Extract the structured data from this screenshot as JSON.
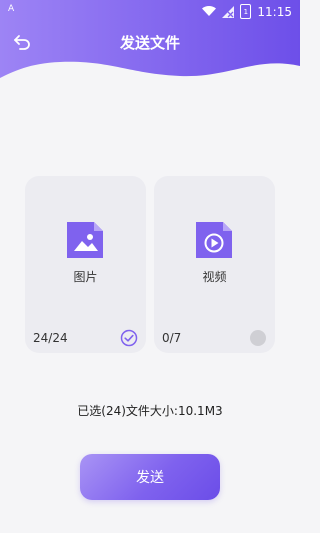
{
  "status_bar": {
    "notification": "A",
    "battery": "1",
    "time": "11:15"
  },
  "header": {
    "title": "发送文件"
  },
  "cards": [
    {
      "label": "图片",
      "count": "24/24",
      "checked": true
    },
    {
      "label": "视频",
      "count": "0/7",
      "checked": false
    }
  ],
  "summary": "已选(24)文件大小:10.1M3",
  "send_label": "发送",
  "colors": {
    "accent": "#7f62ee",
    "header_start": "#9d84f5",
    "header_end": "#6d4fe9",
    "card_bg": "#ececf1"
  }
}
